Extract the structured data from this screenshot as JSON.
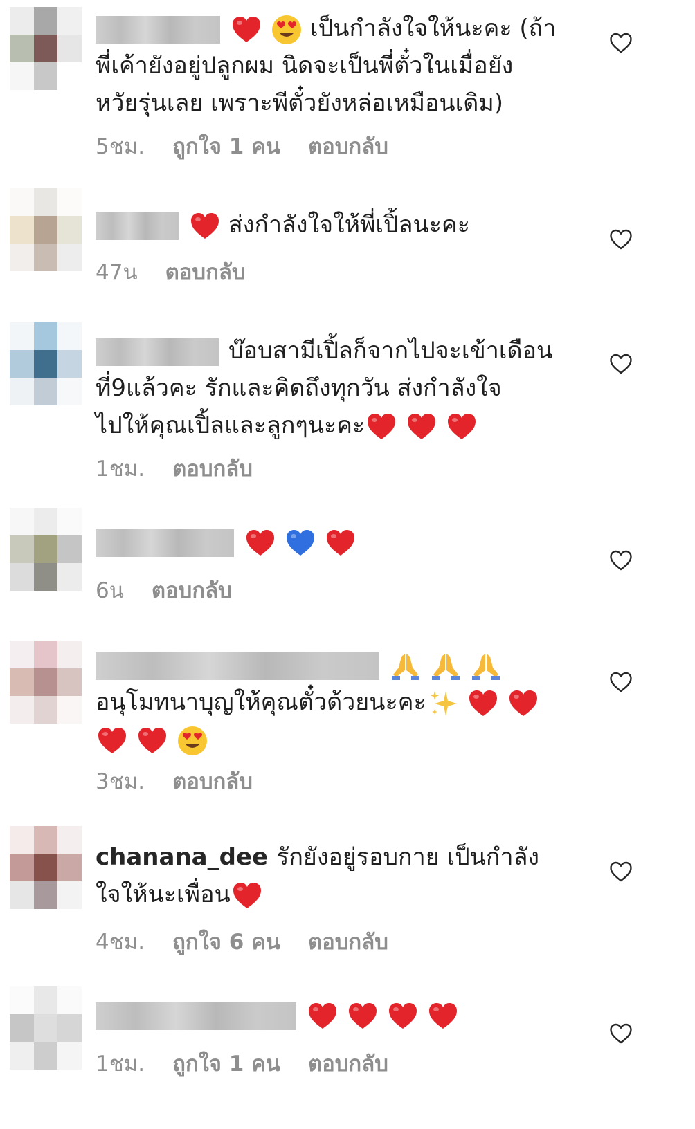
{
  "comments": [
    {
      "username_blurred": true,
      "username": "",
      "lines": [
        {
          "emojis_before": [
            "red-heart",
            "heart-eyes"
          ],
          "text": "เป็นกำลังใจให้นะคะ (ถ้า"
        },
        {
          "text": "พี่เค้ายังอยู่ปลูกผม นิดจะเป็นพี่ตั๋วในเมื่อยัง"
        },
        {
          "text": "หวัยรุ่นเลย เพราะพีตั๋วยังหล่อเหมือนเดิม)"
        }
      ],
      "time": "5ชม.",
      "likes": "ถูกใจ 1 คน",
      "reply": "ตอบกลับ",
      "avatar_colors": [
        "#ececec",
        "#a8a8a8",
        "#f0f0f0",
        "#b9bfb0",
        "#7d5a57",
        "#e6e6e6",
        "#f6f6f6",
        "#c8c8c8",
        "#ffffff"
      ]
    },
    {
      "username_blurred": true,
      "username": "",
      "lines": [
        {
          "emojis_before": [
            "red-heart"
          ],
          "text": "ส่งกำลังใจให้พี่เปิ้ลนะคะ"
        }
      ],
      "time": "47น",
      "likes": "",
      "reply": "ตอบกลับ",
      "avatar_colors": [
        "#fbf9f8",
        "#e9e7e3",
        "#fdfbfa",
        "#ede3cc",
        "#b8a493",
        "#e6e3d7",
        "#f1eeec",
        "#c9bdb3",
        "#ededed"
      ]
    },
    {
      "username_blurred": true,
      "username": "",
      "lines": [
        {
          "text": "บ๊อบสามีเปิ้ลก็จากไปจะเข้าเดือน"
        },
        {
          "text": "ที่9แล้วคะ รักและคิดถึงทุกวัน  ส่งกำลังใจ"
        },
        {
          "text": "ไปให้คุณเปิ้ลและลูกๆนะคะ",
          "emojis_after": [
            "red-heart",
            "red-heart",
            "red-heart"
          ]
        }
      ],
      "time": "1ชม.",
      "likes": "",
      "reply": "ตอบกลับ",
      "avatar_colors": [
        "#f3f6f8",
        "#a5c8de",
        "#f4f7f9",
        "#b2cbdc",
        "#3f6f8c",
        "#c5d6e2",
        "#eef2f4",
        "#c1ccd6",
        "#f7f8f9"
      ]
    },
    {
      "username_blurred": true,
      "username": "",
      "lines": [
        {
          "emojis_after": [
            "red-heart",
            "blue-heart",
            "red-heart"
          ],
          "text": ""
        }
      ],
      "time": "6น",
      "likes": "",
      "reply": "ตอบกลับ",
      "avatar_colors": [
        "#f7f7f7",
        "#ececec",
        "#fafafa",
        "#c9c9bb",
        "#a3a280",
        "#c5c5c5",
        "#dcdcdc",
        "#8f8f88",
        "#ececec"
      ]
    },
    {
      "username_blurred": true,
      "username": "",
      "lines": [
        {
          "emojis_after": [
            "folded-hands",
            "folded-hands",
            "folded-hands"
          ],
          "text": ""
        },
        {
          "text": "อนุโมทนาบุญให้คุณตั๋วด้วยนะคะ",
          "emojis_after": [
            "sparkles",
            "red-heart",
            "red-heart"
          ]
        },
        {
          "text": "",
          "emojis_after": [
            "red-heart",
            "red-heart",
            "heart-eyes"
          ]
        }
      ],
      "time": "3ชม.",
      "likes": "",
      "reply": "ตอบกลับ",
      "avatar_colors": [
        "#f5eef0",
        "#e5c5c9",
        "#f4eeef",
        "#d8bcb4",
        "#b6918f",
        "#d7c3c0",
        "#f3eded",
        "#e1d3d2",
        "#faf6f6"
      ]
    },
    {
      "username_blurred": false,
      "username": "chanana_dee",
      "lines": [
        {
          "text": "รักยังอยู่รอบกาย เป็นกำลัง"
        },
        {
          "text": "ใจให้นะเพื่อน",
          "emojis_after": [
            "red-heart"
          ]
        }
      ],
      "time": "4ชม.",
      "likes": "ถูกใจ 6 คน",
      "reply": "ตอบกลับ",
      "avatar_colors": [
        "#f6ebeb",
        "#d7b8b5",
        "#f5eeee",
        "#c39a97",
        "#87524c",
        "#caa8a6",
        "#e6e6e6",
        "#a89a9c",
        "#f3f3f3"
      ]
    },
    {
      "username_blurred": true,
      "username": "",
      "lines": [
        {
          "emojis_after": [
            "red-heart",
            "red-heart",
            "red-heart",
            "red-heart"
          ],
          "text": ""
        }
      ],
      "time": "1ชม.",
      "likes": "ถูกใจ 1 คน",
      "reply": "ตอบกลับ",
      "avatar_colors": [
        "#fbfbfb",
        "#e8e8e8",
        "#fafafa",
        "#c6c6c6",
        "#dedede",
        "#d6d6d6",
        "#efefef",
        "#cdcdcd",
        "#f5f5f5"
      ]
    }
  ],
  "heart_like_icon": "heart-outline-icon",
  "colors": {
    "text": "#262626",
    "meta": "#8e8e8e",
    "red_heart": "#e3252b",
    "blue_heart": "#2f6fe0"
  }
}
